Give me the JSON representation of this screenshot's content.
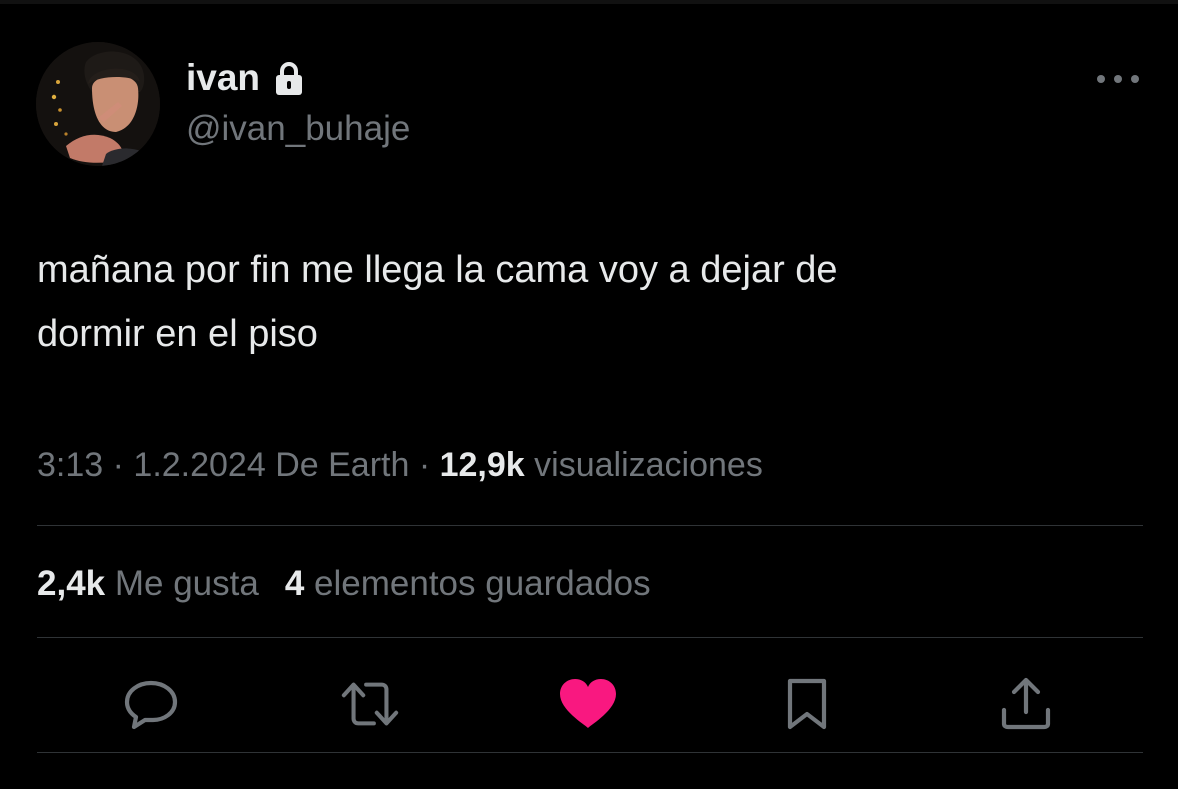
{
  "user": {
    "display_name": "ivan",
    "handle": "@ivan_buhaje",
    "protected_icon": "lock-icon",
    "avatar_icon": "avatar-photo"
  },
  "tweet": {
    "text_line1": "mañana por fin me llega la cama voy a dejar de",
    "text_line2": "dormir en el piso"
  },
  "meta": {
    "time": "3:13",
    "separator1": " · ",
    "date": "1.2.2024",
    "source": " De Earth",
    "separator2": " · ",
    "views_count": "12,9k",
    "views_label": " visualizaciones"
  },
  "stats": {
    "likes_count": "2,4k",
    "likes_label": " Me gusta",
    "bookmarks_count": "4",
    "bookmarks_label": " elementos guardados"
  },
  "actions": [
    {
      "icon": "reply-icon"
    },
    {
      "icon": "retweet-icon"
    },
    {
      "icon": "heart-icon",
      "active": true
    },
    {
      "icon": "bookmark-icon"
    },
    {
      "icon": "share-icon"
    }
  ],
  "colors": {
    "background": "#000000",
    "primary_text": "#e7e9ea",
    "secondary_text": "#71767b",
    "divider": "#2f3336",
    "like_active": "#f91880"
  }
}
